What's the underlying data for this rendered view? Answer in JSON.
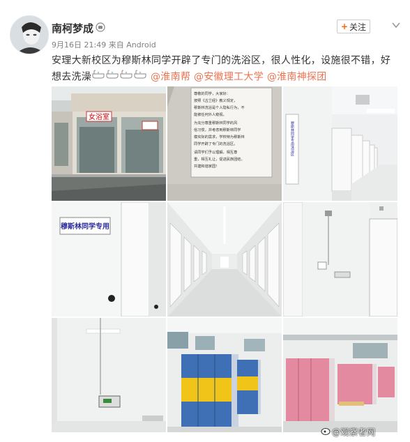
{
  "post": {
    "username": "南柯梦成",
    "time": "9月16日 21:49",
    "source_prefix": "来自",
    "source": "Android",
    "follow_label": "关注",
    "text_main": "安理大新校区为穆斯林同学开辟了专门的洗浴区，很人性化，设施很不错，好想去洗澡",
    "tags": [
      "@淮南帮",
      "@安徽理工大学",
      "@淮南神探团"
    ],
    "watermark": "@观察者网"
  },
  "photos": {
    "p1_sign": "女浴室",
    "p2_notice": [
      "尊敬的同学，大家好：",
      "按照《古兰经》教义规定，",
      "穆斯林洗浴是个人隐私行为，不",
      "能被任何外人窥视。",
      "为充分尊重穆斯林同学的风",
      "俗习惯，并考虑到穆斯林同学",
      "模实际的需求，学校特为穆斯林",
      "同学开辟了专门的洗浴区。",
      "请同学们予以理解，相互尊",
      "重，相互礼让，促进民族团结，",
      "共建和谐家园！"
    ],
    "p3_sign": "穆斯林同学专用洗浴区",
    "p4_sign": "穆斯林同学专用"
  },
  "colors": {
    "tag": "#eb7350",
    "text": "#333333",
    "meta": "#808080",
    "follow_plus": "#ff6600",
    "locker_blue": "#3f6fb4",
    "locker_yellow": "#f0c419",
    "locker_pink": "#e38aa0"
  },
  "icons": [
    "avatar",
    "vip-icon",
    "chevron-down-icon",
    "bathtub-icon",
    "weibo-logo-icon"
  ]
}
